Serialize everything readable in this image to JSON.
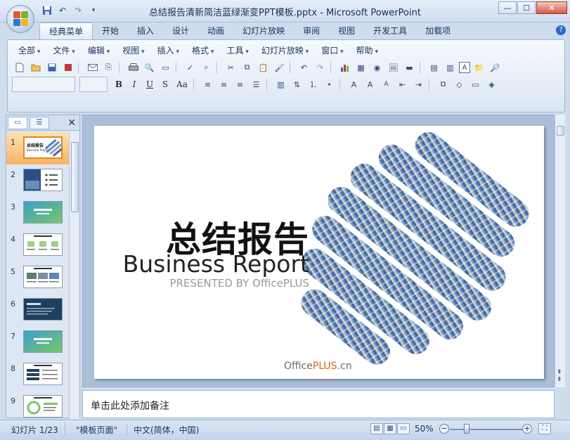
{
  "window": {
    "title": "总结报告清新简洁蓝绿渐变PPT模板.pptx - Microsoft PowerPoint",
    "controls": [
      "—",
      "☐",
      "✕"
    ]
  },
  "ribbon_tabs": [
    "经典菜单",
    "开始",
    "插入",
    "设计",
    "动画",
    "幻灯片放映",
    "审阅",
    "视图",
    "开发工具",
    "加载项"
  ],
  "active_tab": "经典菜单",
  "menus": [
    "全部",
    "文件",
    "编辑",
    "视图",
    "插入",
    "格式",
    "工具",
    "幻灯片放映",
    "窗口",
    "帮助"
  ],
  "format_buttons": {
    "bold": "B",
    "italic": "I",
    "underline": "U",
    "shadow": "S",
    "case": "Aa"
  },
  "slides": {
    "numbers": [
      "1",
      "2",
      "3",
      "4",
      "5",
      "6",
      "7",
      "8",
      "9"
    ],
    "selected_index": 0
  },
  "slide": {
    "title": "总结报告",
    "subtitle": "Business Report",
    "presented": "PRESENTED BY OfficePLUS",
    "brand_prefix": "Office",
    "brand_accent": "PLUS",
    "brand_suffix": ".cn"
  },
  "notes_placeholder": "单击此处添加备注",
  "status": {
    "slide_info": "幻灯片 1/23",
    "theme": "\"模板页面\"",
    "language": "中文(简体，中国)",
    "zoom": "50%",
    "zoom_fraction": 0.5
  },
  "colors": {
    "accent_orange": "#e0661e",
    "selection": "#f7b463",
    "ribbon_blue": "#9fb6d6"
  }
}
